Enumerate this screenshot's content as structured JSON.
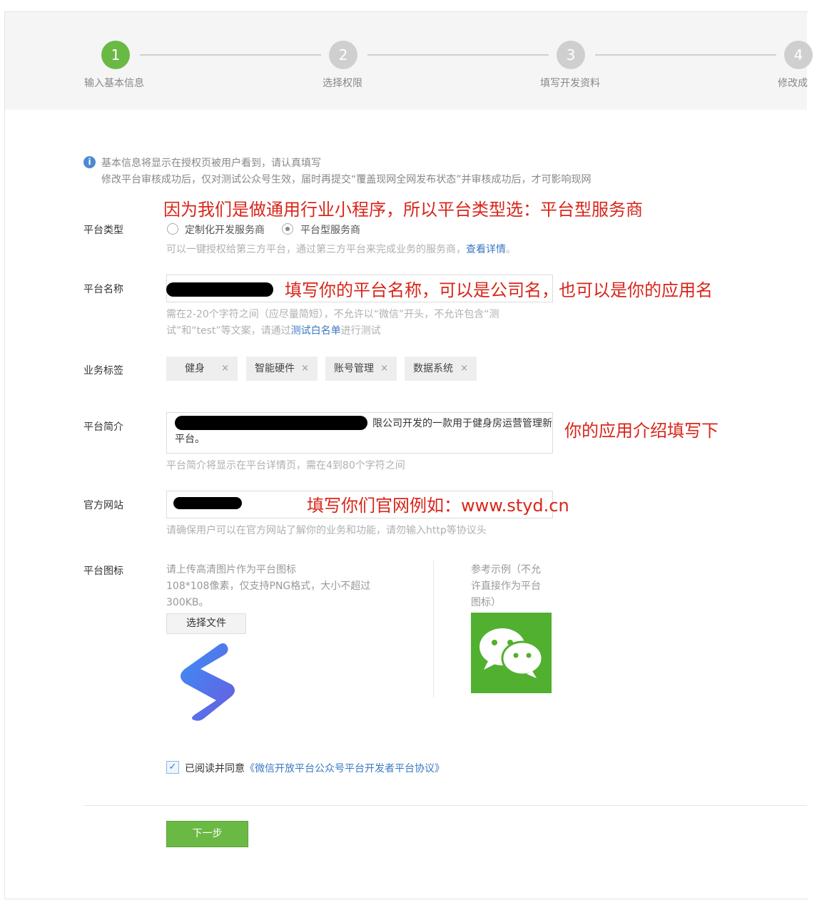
{
  "steps": [
    {
      "num": "1",
      "label": "输入基本信息",
      "state": "active"
    },
    {
      "num": "2",
      "label": "选择权限",
      "state": "todo"
    },
    {
      "num": "3",
      "label": "填写开发资料",
      "state": "todo"
    },
    {
      "num": "4",
      "label": "修改成",
      "state": "todo"
    }
  ],
  "notice": {
    "line1": "基本信息将显示在授权页被用户看到，请认真填写",
    "line2": "修改平台审核成功后，仅对测试公众号生效，届时再提交“覆盖现网全网发布状态”并审核成功后，才可影响现网"
  },
  "annotations": {
    "type": "因为我们是做通用行业小程序，所以平台类型选：平台型服务商",
    "name": "填写你的平台名称，可以是公司名，也可以是你的应用名",
    "intro": "你的应用介绍填写下",
    "site": "填写你们官网例如：www.styd.cn"
  },
  "form": {
    "type": {
      "label": "平台类型",
      "options": [
        "定制化开发服务商",
        "平台型服务商"
      ],
      "selected": "平台型服务商",
      "hint": "可以一键授权给第三方平台，通过第三方平台来完成业务的服务商，",
      "hint_link": "查看详情",
      "hint_end": "。"
    },
    "name": {
      "label": "平台名称",
      "hint_line1": "需在2-20个字符之间（应尽量简短），不允许以“微信”开头，不允许包含“测",
      "hint_line2_a": "试”和“test”等文案，请通过",
      "hint_link": "测试白名单",
      "hint_line2_b": "进行测试"
    },
    "tags": {
      "label": "业务标签",
      "items": [
        "健身",
        "智能硬件",
        "账号管理",
        "数据系统"
      ],
      "remove_glyph": "×"
    },
    "intro": {
      "label": "平台简介",
      "value_line1": "限公司开发的一款用于健身房运营管理新",
      "value_line2": "平台。",
      "hint": "平台简介将显示在平台详情页，需在4到80个字符之间"
    },
    "website": {
      "label": "官方网站",
      "hint": "请确保用户可以在官方网站了解你的业务和功能，请勿输入http等协议头"
    },
    "icon": {
      "label": "平台图标",
      "desc_line1": "请上传高清图片作为平台图标",
      "desc_line2": "108*108像素，仅支持PNG格式，大小不超过",
      "desc_line3": "300KB。",
      "file_button": "选择文件",
      "example_line1": "参考示例（不允",
      "example_line2": "许直接作为平台",
      "example_line3": "图标）"
    }
  },
  "agreement": {
    "checked": true,
    "prefix": "已阅读并同意",
    "link": "《微信开放平台公众号平台开发者平台协议》"
  },
  "next_button": "下一步",
  "colors": {
    "accent_green": "#6bb945",
    "link_blue": "#3a78c3",
    "annotation_red": "#d8261a"
  }
}
